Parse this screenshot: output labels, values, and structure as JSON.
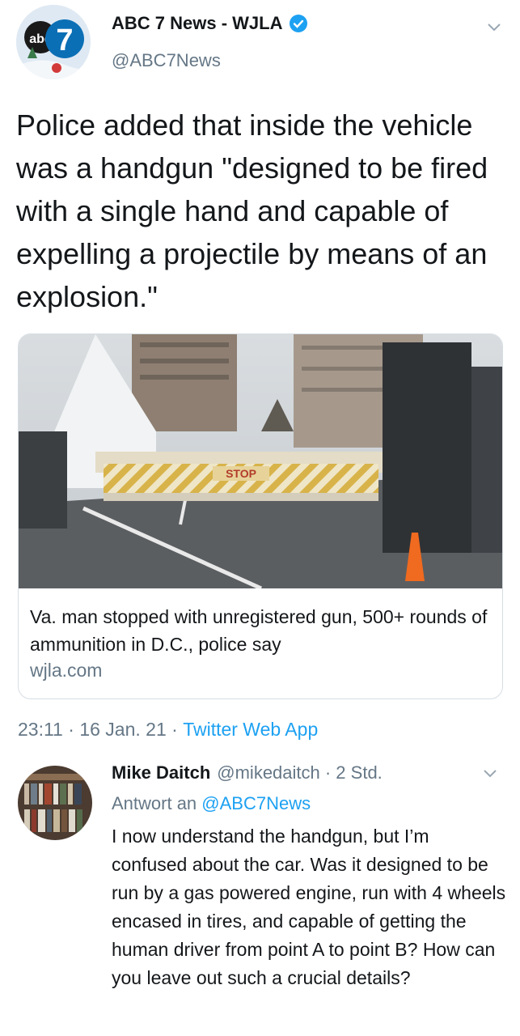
{
  "tweet": {
    "account_name": "ABC 7 News - WJLA",
    "handle": "@ABC7News",
    "logo_text": "abc",
    "logo_number": "7",
    "text": "Police added that inside the vehicle was a handgun \"designed to be fired with a single hand and capable of expelling a projectile by means of an explosion.\""
  },
  "card": {
    "barrier_sign": "STOP",
    "title": "Va. man stopped with unregistered gun, 500+ rounds of ammunition in D.C., police say",
    "domain": "wjla.com"
  },
  "meta": {
    "time": "23:11",
    "sep1": " · ",
    "date": "16 Jan. 21",
    "sep2": " · ",
    "source": "Twitter Web App"
  },
  "reply": {
    "name": "Mike Daitch",
    "handle": "@mikedaitch · 2 Std.",
    "reply_label": "Antwort an ",
    "reply_to": "@ABC7News",
    "text": "I now understand the handgun, but I’m confused about the car. Was it designed to be run by a gas powered engine, run with 4 wheels encased in tires, and capable of getting the human driver from point A to point B? How can you leave out such a crucial details?"
  },
  "colors": {
    "link": "#1da1f2",
    "secondary_text": "#657786",
    "verified": "#1da1f2",
    "abc_blue": "#0b6fb5"
  },
  "icons": [
    "verified-badge-icon",
    "chevron-down-icon"
  ]
}
